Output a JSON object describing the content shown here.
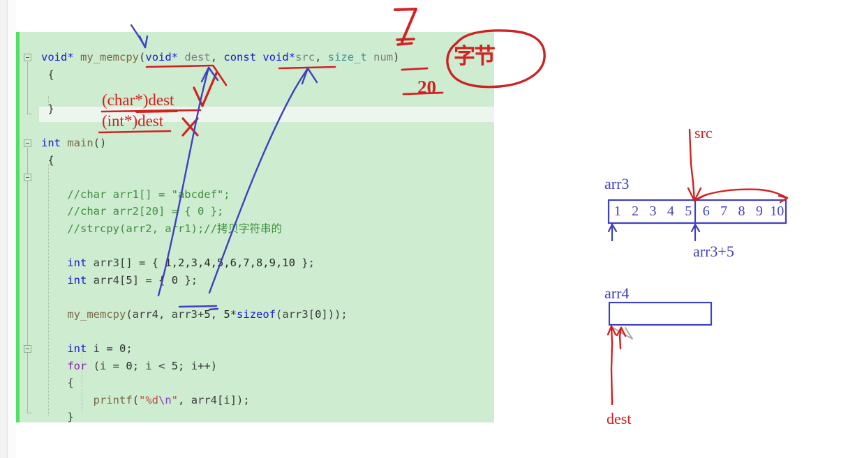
{
  "editor": {
    "language": "c",
    "background_color": "#cdecd0",
    "change_bar_color": "#51e064",
    "current_line_color": "#edf5ef",
    "code_lines": [
      {
        "tokens": [
          {
            "t": "void*",
            "c": "kw"
          },
          {
            "t": " ",
            "c": "plain"
          },
          {
            "t": "my_memcpy",
            "c": "fn"
          },
          {
            "t": "(",
            "c": "plain"
          },
          {
            "t": "void*",
            "c": "kw"
          },
          {
            "t": " ",
            "c": "plain"
          },
          {
            "t": "dest",
            "c": "var"
          },
          {
            "t": ", ",
            "c": "plain"
          },
          {
            "t": "const",
            "c": "kw"
          },
          {
            "t": " ",
            "c": "plain"
          },
          {
            "t": "void*",
            "c": "kw"
          },
          {
            "t": "src",
            "c": "var"
          },
          {
            "t": ", ",
            "c": "plain"
          },
          {
            "t": "size_t",
            "c": "typ"
          },
          {
            "t": " ",
            "c": "plain"
          },
          {
            "t": "num",
            "c": "var"
          },
          {
            "t": ")",
            "c": "plain"
          }
        ]
      },
      {
        "tokens": [
          {
            "t": " {",
            "c": "plain"
          }
        ]
      },
      {
        "tokens": [
          {
            "t": "",
            "c": "plain"
          }
        ]
      },
      {
        "tokens": [
          {
            "t": " }",
            "c": "plain"
          }
        ]
      },
      {
        "tokens": [
          {
            "t": "",
            "c": "plain"
          }
        ]
      },
      {
        "tokens": [
          {
            "t": "int",
            "c": "kw"
          },
          {
            "t": " ",
            "c": "plain"
          },
          {
            "t": "main",
            "c": "fn"
          },
          {
            "t": "()",
            "c": "plain"
          }
        ]
      },
      {
        "tokens": [
          {
            "t": " {",
            "c": "plain"
          }
        ]
      },
      {
        "tokens": [
          {
            "t": "",
            "c": "plain"
          }
        ]
      },
      {
        "tokens": [
          {
            "t": "    //char arr1[] = \"abcdef\";",
            "c": "cmt"
          }
        ]
      },
      {
        "tokens": [
          {
            "t": "    //char arr2[20] = { 0 };",
            "c": "cmt"
          }
        ]
      },
      {
        "tokens": [
          {
            "t": "    //strcpy(arr2, arr1);//拷贝字符串的",
            "c": "cmt"
          }
        ]
      },
      {
        "tokens": [
          {
            "t": "",
            "c": "plain"
          }
        ]
      },
      {
        "tokens": [
          {
            "t": "    ",
            "c": "plain"
          },
          {
            "t": "int",
            "c": "kw"
          },
          {
            "t": " ",
            "c": "plain"
          },
          {
            "t": "arr3",
            "c": "id"
          },
          {
            "t": "[] = { ",
            "c": "plain"
          },
          {
            "t": "1,2,3,4,5,6,7,8,9,10",
            "c": "num"
          },
          {
            "t": " };",
            "c": "plain"
          }
        ]
      },
      {
        "tokens": [
          {
            "t": "    ",
            "c": "plain"
          },
          {
            "t": "int",
            "c": "kw"
          },
          {
            "t": " ",
            "c": "plain"
          },
          {
            "t": "arr4",
            "c": "id"
          },
          {
            "t": "[",
            "c": "plain"
          },
          {
            "t": "5",
            "c": "num"
          },
          {
            "t": "] = { ",
            "c": "plain"
          },
          {
            "t": "0",
            "c": "num"
          },
          {
            "t": " };",
            "c": "plain"
          }
        ]
      },
      {
        "tokens": [
          {
            "t": "",
            "c": "plain"
          }
        ]
      },
      {
        "tokens": [
          {
            "t": "    ",
            "c": "plain"
          },
          {
            "t": "my_memcpy",
            "c": "fn"
          },
          {
            "t": "(",
            "c": "plain"
          },
          {
            "t": "arr4",
            "c": "id"
          },
          {
            "t": ", ",
            "c": "plain"
          },
          {
            "t": "arr3",
            "c": "id"
          },
          {
            "t": "+",
            "c": "plain"
          },
          {
            "t": "5",
            "c": "num"
          },
          {
            "t": ", ",
            "c": "plain"
          },
          {
            "t": "5",
            "c": "num"
          },
          {
            "t": "*",
            "c": "plain"
          },
          {
            "t": "sizeof",
            "c": "kw"
          },
          {
            "t": "(",
            "c": "plain"
          },
          {
            "t": "arr3",
            "c": "id"
          },
          {
            "t": "[",
            "c": "plain"
          },
          {
            "t": "0",
            "c": "num"
          },
          {
            "t": "]));",
            "c": "plain"
          }
        ]
      },
      {
        "tokens": [
          {
            "t": "",
            "c": "plain"
          }
        ]
      },
      {
        "tokens": [
          {
            "t": "    ",
            "c": "plain"
          },
          {
            "t": "int",
            "c": "kw"
          },
          {
            "t": " ",
            "c": "plain"
          },
          {
            "t": "i",
            "c": "id"
          },
          {
            "t": " = ",
            "c": "plain"
          },
          {
            "t": "0",
            "c": "num"
          },
          {
            "t": ";",
            "c": "plain"
          }
        ]
      },
      {
        "tokens": [
          {
            "t": "    ",
            "c": "plain"
          },
          {
            "t": "for",
            "c": "ctl"
          },
          {
            "t": " (",
            "c": "plain"
          },
          {
            "t": "i",
            "c": "id"
          },
          {
            "t": " = ",
            "c": "plain"
          },
          {
            "t": "0",
            "c": "num"
          },
          {
            "t": "; ",
            "c": "plain"
          },
          {
            "t": "i",
            "c": "id"
          },
          {
            "t": " < ",
            "c": "plain"
          },
          {
            "t": "5",
            "c": "num"
          },
          {
            "t": "; ",
            "c": "plain"
          },
          {
            "t": "i",
            "c": "id"
          },
          {
            "t": "++)",
            "c": "plain"
          }
        ]
      },
      {
        "tokens": [
          {
            "t": "    {",
            "c": "plain"
          }
        ]
      },
      {
        "tokens": [
          {
            "t": "        ",
            "c": "plain"
          },
          {
            "t": "printf",
            "c": "fn"
          },
          {
            "t": "(",
            "c": "plain"
          },
          {
            "t": "\"%d",
            "c": "str"
          },
          {
            "t": "\\n",
            "c": "esc"
          },
          {
            "t": "\"",
            "c": "str"
          },
          {
            "t": ", ",
            "c": "plain"
          },
          {
            "t": "arr4",
            "c": "id"
          },
          {
            "t": "[",
            "c": "plain"
          },
          {
            "t": "i",
            "c": "id"
          },
          {
            "t": "]);",
            "c": "plain"
          }
        ]
      },
      {
        "tokens": [
          {
            "t": "    }",
            "c": "plain"
          }
        ]
      }
    ]
  },
  "annotations": {
    "ink_red": "#d32020",
    "ink_blue": "#4040c0",
    "red_seven": "7",
    "red_twenty": "20",
    "circled_note": "字节",
    "cast_good": "(char*)dest",
    "cast_bad": "(int*)dest",
    "check_mark": "✓",
    "cross_mark": "✗"
  },
  "diagram_arr3": {
    "array_label": "arr3",
    "pointer_src_label": "src",
    "pointer_offset_label": "arr3+5",
    "cells": [
      "1",
      "2",
      "3",
      "4",
      "5",
      "6",
      "7",
      "8",
      "9",
      "10"
    ],
    "split_after_index": 5,
    "box_color": "#4040c0",
    "text_color": "#4040c0"
  },
  "diagram_arr4": {
    "array_label": "arr4",
    "pointer_dest_label": "dest",
    "box_color": "#4040c0",
    "label_color": "#d32020"
  }
}
